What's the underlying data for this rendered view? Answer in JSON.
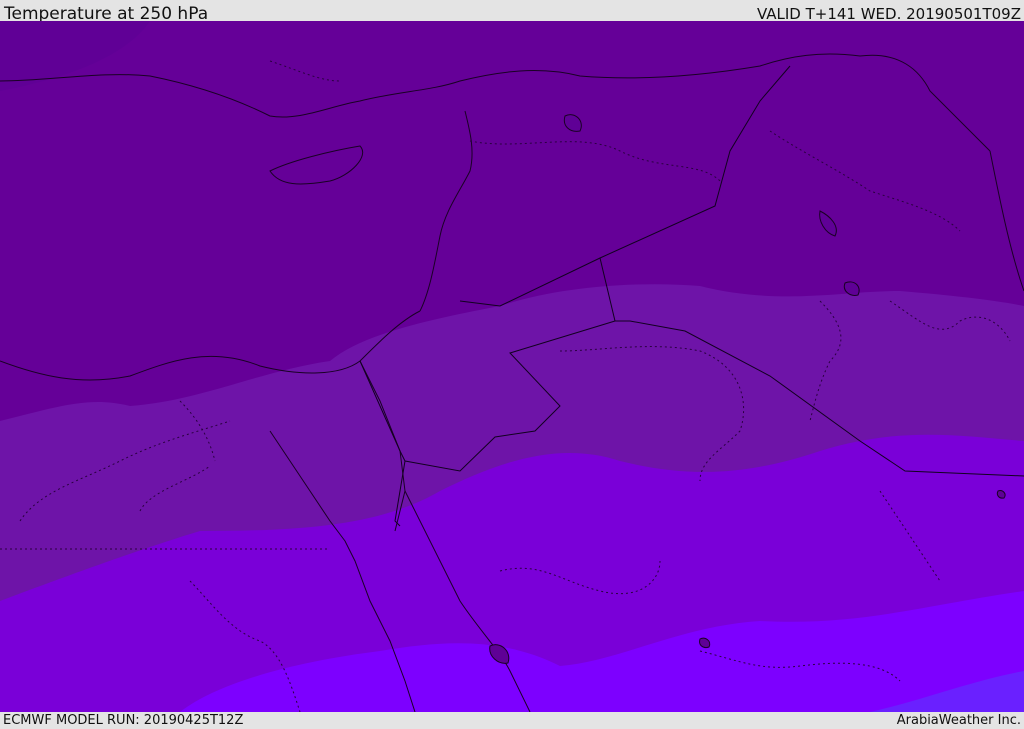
{
  "header": {
    "title": "Temperature at 250 hPa",
    "valid": "VALID T+141 WED. 20190501T09Z"
  },
  "footer": {
    "model_run": "ECMWF MODEL RUN: 20190425T12Z",
    "brand": "ArabiaWeather Inc."
  },
  "temperature_bands": {
    "coldest_north": "#5f0096",
    "cold": "#650098",
    "mid": "#6e14a8",
    "warm": "#7a00d8",
    "warmer": "#7d00ff",
    "warmest_southeast": "#6a20ff"
  },
  "map_colors": {
    "coastline": "#1a0025",
    "border": "#120020",
    "admin_border": "#2a0040"
  }
}
